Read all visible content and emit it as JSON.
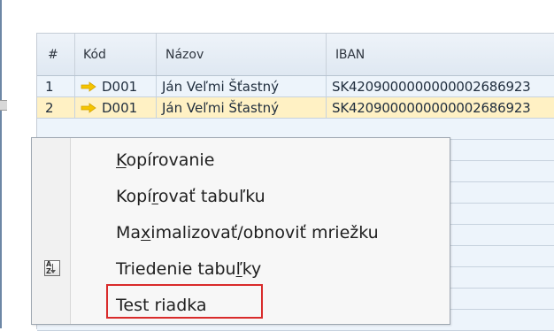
{
  "grid": {
    "headers": {
      "num": "#",
      "kod": "Kód",
      "nazov": "Názov",
      "iban": "IBAN"
    },
    "rows": [
      {
        "num": "1",
        "kod": "D001",
        "nazov": "Ján Veľmi Šťastný",
        "iban": "SK4209000000000002686923",
        "arrow_icon": "right-arrow-icon"
      },
      {
        "num": "2",
        "kod": "D001",
        "nazov": "Ján Veľmi Šťastný",
        "iban": "SK4209000000000002686923",
        "arrow_icon": "right-arrow-icon"
      }
    ]
  },
  "context_menu": {
    "items": [
      {
        "label_parts": [
          "",
          "K",
          "opírovanie"
        ]
      },
      {
        "label_parts": [
          "Kopí",
          "r",
          "ovať tabuľku"
        ]
      },
      {
        "label_parts": [
          "Ma",
          "x",
          "imalizovať/obnoviť mriežku"
        ]
      },
      {
        "label_parts": [
          "Triedenie tabu",
          "ľ",
          "ky"
        ],
        "icon": "sort-table-icon"
      },
      {
        "label_parts": [
          "Test riadka",
          "",
          ""
        ]
      }
    ]
  },
  "colors": {
    "row_selected": "#fff1c4",
    "row_normal": "#edf4fb",
    "highlight_border": "#d92b2b",
    "arrow": "#f5c400"
  }
}
